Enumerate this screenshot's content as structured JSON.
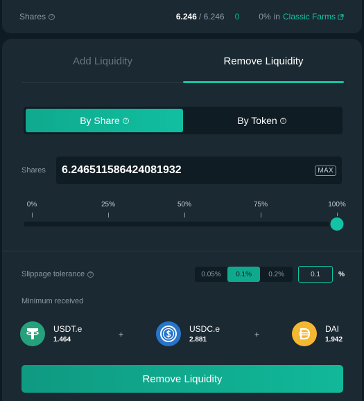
{
  "top": {
    "shares_label": "Shares",
    "shares_amount": "6.246",
    "shares_total": "/ 6.246",
    "farm_count": "0",
    "percent": "0%",
    "in_text": "in",
    "farm_link": "Classic Farms"
  },
  "tabs": {
    "add": "Add Liquidity",
    "remove": "Remove Liquidity",
    "active": "remove"
  },
  "segment": {
    "by_share": "By Share",
    "by_token": "By Token",
    "active": "by_share"
  },
  "shares_input": {
    "label": "Shares",
    "value": "6.246511586424081932",
    "max_label": "MAX"
  },
  "slider": {
    "ticks": [
      "0%",
      "25%",
      "50%",
      "75%",
      "100%"
    ],
    "value_percent": 100
  },
  "slippage": {
    "label": "Slippage tolerance",
    "options": [
      "0.05%",
      "0.1%",
      "0.2%"
    ],
    "active_index": 1,
    "custom_value": "0.1",
    "unit": "%"
  },
  "minimum": {
    "label": "Minimum received"
  },
  "tokens": [
    {
      "symbol": "USDT.e",
      "amount": "1.464",
      "icon": "usdt-icon",
      "color": "#26a17b"
    },
    {
      "symbol": "USDC.e",
      "amount": "2.881",
      "icon": "usdc-icon",
      "color": "#2775ca"
    },
    {
      "symbol": "DAI",
      "amount": "1.942",
      "icon": "dai-icon",
      "color": "#f4b731"
    }
  ],
  "plus_sign": "+",
  "submit_label": "Remove Liquidity",
  "colors": {
    "accent": "#12c3a5",
    "background": "#0f1b24",
    "card": "#1b2932"
  }
}
